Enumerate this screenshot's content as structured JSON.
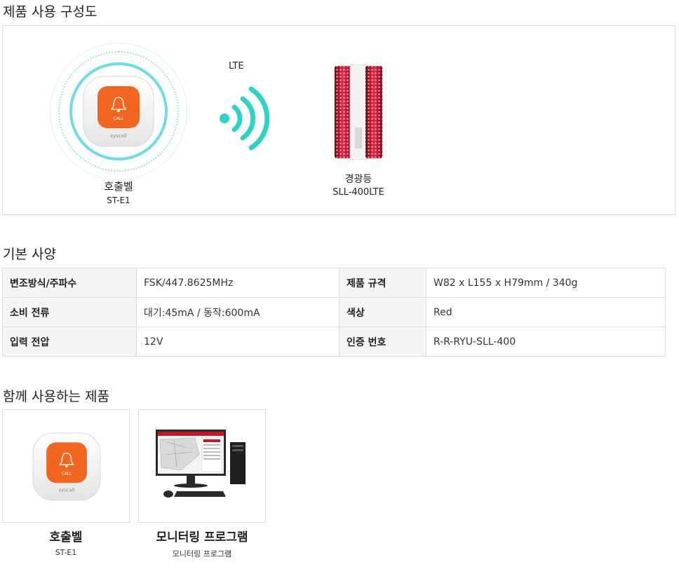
{
  "sections": {
    "config_title": "제품 사용 구성도",
    "spec_title": "기본 사양",
    "related_title": "함께 사용하는 제품"
  },
  "diagram": {
    "bell_name": "호출벨",
    "bell_model": "ST-E1",
    "bell_button_text": "CALL",
    "bell_brand": "syscall",
    "link_label": "LTE",
    "beacon_name": "경광등",
    "beacon_model": "SLL-400LTE"
  },
  "specs": [
    {
      "label": "변조방식/주파수",
      "value": "FSK/447.8625MHz",
      "label2": "제품 규격",
      "value2": "W82 x L155 x H79mm / 340g"
    },
    {
      "label": "소비 전류",
      "value": "대기:45mA / 동작:600mA",
      "label2": "색상",
      "value2": "Red"
    },
    {
      "label": "입력 전압",
      "value": "12V",
      "label2": "인증 번호",
      "value2": "R-R-RYU-SLL-400"
    }
  ],
  "products": [
    {
      "name": "호출벨",
      "sub": "ST-E1"
    },
    {
      "name": "모니터링 프로그램",
      "sub": "모니터링 프로그램"
    }
  ],
  "colors": {
    "accent_teal": "#2fd3c3",
    "bell_orange": "#f0651f",
    "beacon_red": "#d0102a"
  }
}
